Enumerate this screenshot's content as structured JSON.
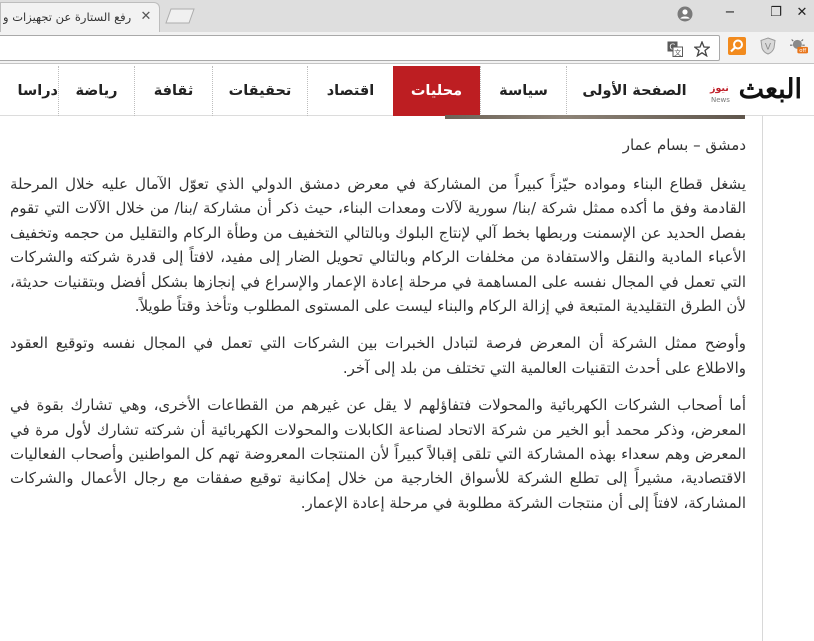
{
  "browser": {
    "tab": {
      "title": "رفع الستارة عن تجهيزات و"
    },
    "omnibox": {
      "url": ""
    },
    "icons": [
      "close-icon",
      "new-tab-icon",
      "profile-icon",
      "minimize-icon",
      "maximize-icon",
      "close-window-icon",
      "translate-icon",
      "star-icon",
      "search-extension-icon",
      "shield-extension-icon",
      "bug-extension-icon"
    ],
    "extension_badge": "off",
    "window_controls": {
      "minimize": "−",
      "maximize": "❐",
      "close": "✕"
    }
  },
  "site": {
    "logo": {
      "text": "البعث",
      "subtitle": "نيوز",
      "news": "News"
    },
    "nav": [
      {
        "label": "الصفحة الأولى",
        "active": false
      },
      {
        "label": "سياسة",
        "active": false
      },
      {
        "label": "محليات",
        "active": true
      },
      {
        "label": "اقتصاد",
        "active": false
      },
      {
        "label": "تحقيقات",
        "active": false
      },
      {
        "label": "ثقافة",
        "active": false
      },
      {
        "label": "رياضة",
        "active": false
      },
      {
        "label": "دراسا",
        "active": false
      }
    ],
    "accent_color": "#bd1e22"
  },
  "article": {
    "author_line": "دمشق – بسام عمار",
    "paragraphs": [
      "يشغل قطاع البناء ومواده حيّزاً كبيراً من المشاركة في معرض دمشق الدولي الذي تعوّل الآمال عليه خلال المرحلة القادمة وفق ما أكده ممثل شركة /بنا/ سورية لآلات ومعدات البناء، حيث ذكر أن مشاركة /بنا/ من خلال الآلات التي تقوم بفصل الحديد عن الإسمنت وربطها بخط آلي لإنتاج البلوك وبالتالي التخفيف من وطأة الركام والتقليل من حجمه وتخفيف الأعباء المادية والنقل والاستفادة من مخلفات الركام وبالتالي تحويل الضار إلى مفيد، لافتاً إلى قدرة شركته والشركات التي تعمل في المجال نفسه على المساهمة في مرحلة إعادة الإعمار والإسراع في إنجازها بشكل أفضل وبتقنيات حديثة، لأن الطرق التقليدية المتبعة في إزالة الركام والبناء ليست على المستوى المطلوب وتأخذ وقتاً طويلاً.",
      "وأوضح ممثل الشركة أن المعرض فرصة لتبادل الخبرات بين الشركات التي تعمل في المجال نفسه وتوقيع العقود والاطلاع على أحدث التقنيات العالمية التي تختلف من بلد إلى آخر.",
      "أما أصحاب الشركات الكهربائية والمحولات فتفاؤلهم لا يقل عن غيرهم من القطاعات الأخرى، وهي تشارك بقوة في المعرض، وذكر محمد أبو الخير من شركة الاتحاد لصناعة الكابلات والمحولات الكهربائية أن شركته تشارك لأول مرة في المعرض وهم سعداء بهذه المشاركة التي تلقى إقبالاً كبيراً لأن المنتجات المعروضة تهم كل المواطنين وأصحاب الفعاليات الاقتصادية، مشيراً إلى تطلع الشركة للأسواق الخارجية من خلال إمكانية توقيع صفقات مع رجال الأعمال والشركات المشاركة، لافتاً إلى أن منتجات الشركة مطلوبة في مرحلة إعادة الإعمار."
    ]
  }
}
